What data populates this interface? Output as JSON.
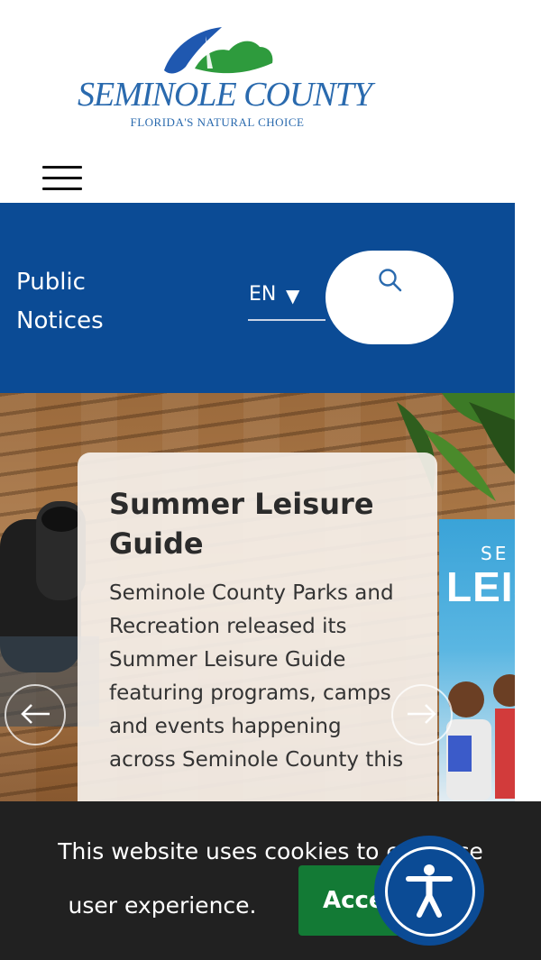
{
  "logo": {
    "name": "SEMINOLE COUNTY",
    "tagline": "FLORIDA'S NATURAL CHOICE"
  },
  "nav": {
    "menu_icon": "hamburger-menu-icon"
  },
  "topbar": {
    "public_notices": "Public Notices",
    "language": "EN",
    "language_caret": "▼",
    "search_icon": "search-icon"
  },
  "slider": {
    "slide": {
      "title": "Summer Leisure Guide",
      "body": "Seminole County Parks and Recreation released its Summer Leisure Guide featuring programs, camps and events happening across Seminole County this"
    },
    "magazine_cover": {
      "small": "SE",
      "big": "LEIS"
    },
    "prev_icon": "arrow-left-icon",
    "next_icon": "arrow-right-icon"
  },
  "cookie_banner": {
    "line1": "This website uses cookies to enhance",
    "line2": "user experience.",
    "accept_label": "Accept"
  },
  "accessibility": {
    "icon": "accessibility-icon"
  },
  "colors": {
    "brand_blue": "#0b4b95",
    "logo_blue": "#2a6aae",
    "logo_green": "#2e9b3d",
    "accept_green": "#137a35",
    "banner_bg": "#212121"
  }
}
